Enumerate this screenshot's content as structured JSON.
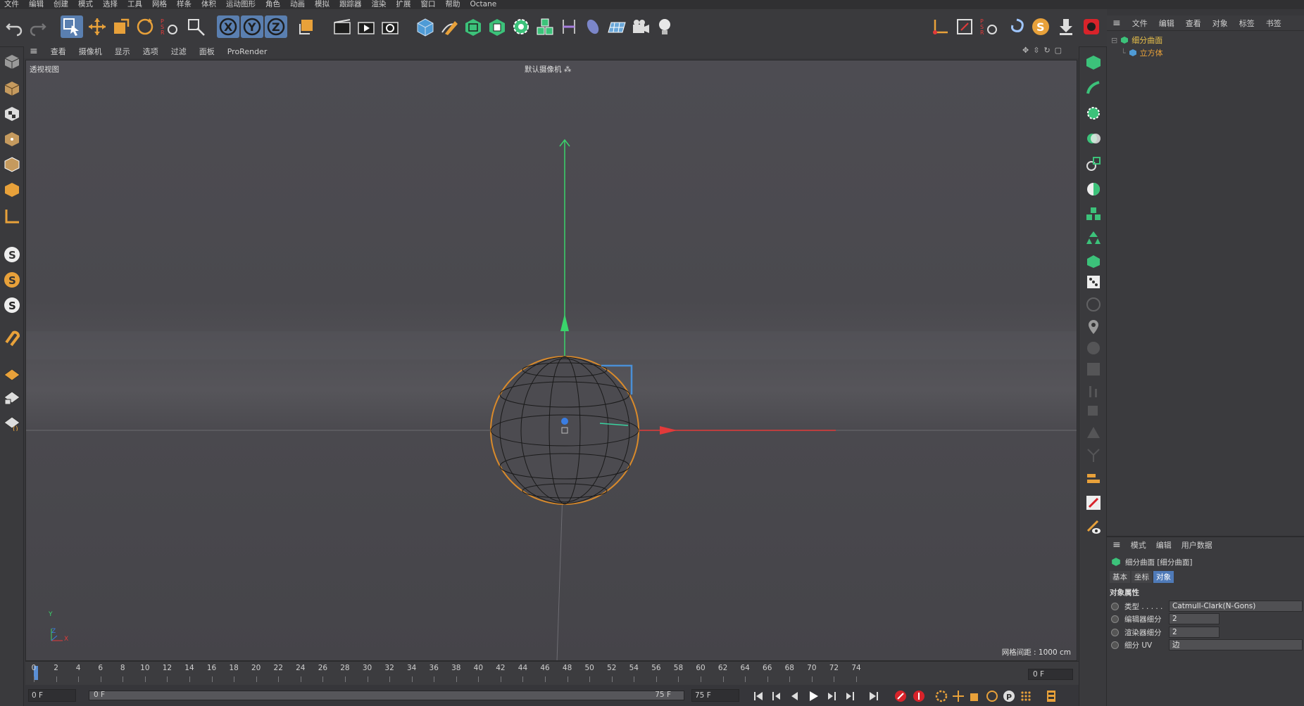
{
  "menubar": [
    "文件",
    "编辑",
    "创建",
    "模式",
    "选择",
    "工具",
    "网格",
    "样条",
    "体积",
    "运动图形",
    "角色",
    "动画",
    "模拟",
    "跟踪器",
    "渲染",
    "扩展",
    "窗口",
    "帮助",
    "Octane"
  ],
  "viewport": {
    "menu": [
      "查看",
      "摄像机",
      "显示",
      "选项",
      "过滤",
      "面板",
      "ProRender"
    ],
    "view_name": "透视视图",
    "camera_name": "默认摄像机",
    "grid_spacing": "网格间距 : 1000 cm",
    "axis_y": "Y",
    "axis_z": "Z",
    "axis_x": "X"
  },
  "object_manager": {
    "menu": [
      "文件",
      "编辑",
      "查看",
      "对象",
      "标签",
      "书签"
    ],
    "items": [
      {
        "label": "细分曲面",
        "color": "#e8c04a"
      },
      {
        "label": "立方体",
        "color": "#e8a13a"
      }
    ]
  },
  "attribute_manager": {
    "menu": [
      "模式",
      "编辑",
      "用户数据"
    ],
    "title": "细分曲面 [细分曲面]",
    "tabs": [
      "基本",
      "坐标",
      "对象"
    ],
    "active_tab": "对象",
    "section": "对象属性",
    "fields": [
      {
        "label": "类型 . . . . .",
        "value": "Catmull-Clark(N-Gons)"
      },
      {
        "label": "编辑器细分",
        "value": "2"
      },
      {
        "label": "渲染器细分",
        "value": "2"
      },
      {
        "label": "细分 UV",
        "value": "边"
      }
    ]
  },
  "timeline": {
    "ticks": [
      "0",
      "2",
      "4",
      "6",
      "8",
      "10",
      "12",
      "14",
      "16",
      "18",
      "20",
      "22",
      "24",
      "26",
      "28",
      "30",
      "32",
      "34",
      "36",
      "38",
      "40",
      "42",
      "44",
      "46",
      "48",
      "50",
      "52",
      "54",
      "56",
      "58",
      "60",
      "62",
      "64",
      "66",
      "68",
      "70",
      "72",
      "74"
    ],
    "current_frame_right": "0 F",
    "start_field": "0 F",
    "range_start": "0 F",
    "range_end": "75 F",
    "end_field": "75 F"
  },
  "colors": {
    "accent_orange": "#e8a13a",
    "axis_x": "#e23a3a",
    "axis_y": "#3ad36b",
    "axis_z": "#3a7de2",
    "selection": "#d98a2b"
  }
}
